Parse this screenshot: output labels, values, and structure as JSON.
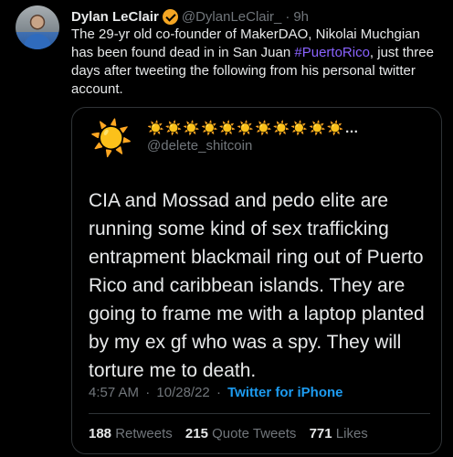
{
  "tweet": {
    "author_name": "Dylan LeClair",
    "author_handle": "@DylanLeClair_",
    "separator": "·",
    "time_ago": "9h",
    "text_before": "The 29-yr old co-founder of MakerDAO, Nikolai Muchgian has been found dead in in San Juan ",
    "hashtag": "#PuertoRico",
    "text_after": ", just three days after tweeting the following from his personal twitter account.",
    "verified_color": "#f5a623",
    "hashtag_color": "#8a63ff"
  },
  "quoted": {
    "avatar_icon": "☀️",
    "display_name": "☀️☀️☀️☀️☀️☀️☀️☀️☀️☀️☀️…",
    "handle": "@delete_shitcoin",
    "text": "CIA and Mossad and pedo elite are running some kind of sex trafficking entrapment blackmail ring out of Puerto Rico and caribbean islands. They are going to frame me with a laptop planted by my ex gf who was a spy. They will torture me to death.",
    "time": "4:57 AM",
    "meta_separator": "·",
    "date": "10/28/22",
    "source_separator": "·",
    "source": "Twitter for iPhone",
    "retweets_count": "188",
    "retweets_label": "Retweets",
    "quote_tweets_count": "215",
    "quote_tweets_label": "Quote Tweets",
    "likes_count": "771",
    "likes_label": "Likes"
  }
}
